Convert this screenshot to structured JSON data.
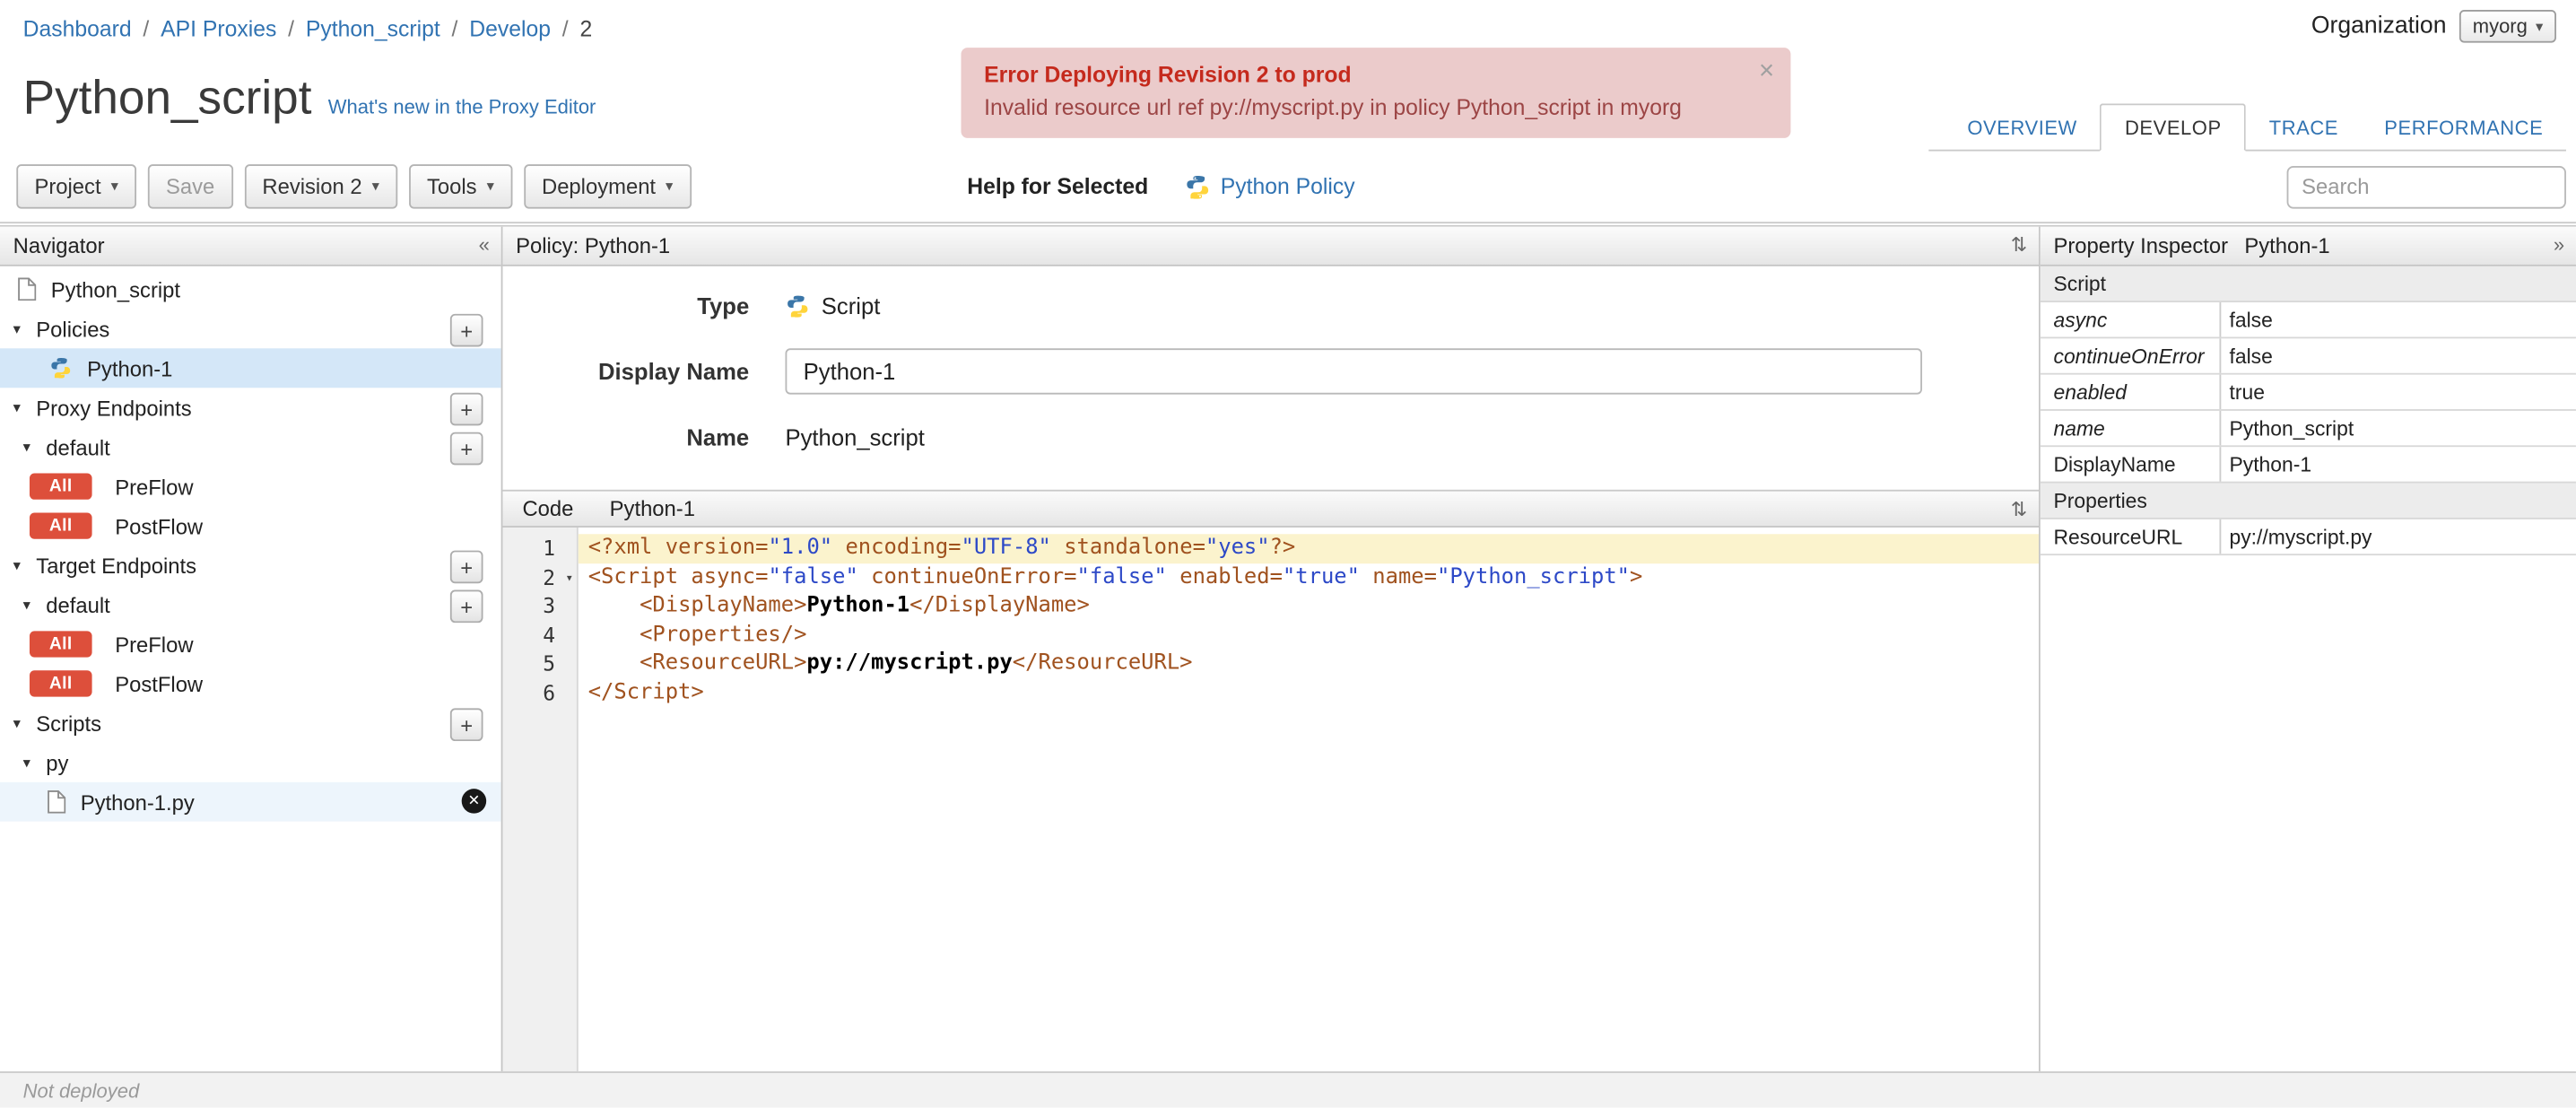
{
  "icons": {
    "caret_down": "▾",
    "collapse_left": "«",
    "expand_right": "»",
    "panel_toggle": "⇅",
    "close": "×",
    "plus": "+",
    "tree_expanded": "▾",
    "delete": "✕"
  },
  "breadcrumb": {
    "sep": "/",
    "items": [
      "Dashboard",
      "API Proxies",
      "Python_script",
      "Develop",
      "2"
    ]
  },
  "organization": {
    "label": "Organization",
    "value": "myorg"
  },
  "error_banner": {
    "title": "Error Deploying Revision 2 to prod",
    "message": "Invalid resource url ref py://myscript.py in policy Python_script in myorg"
  },
  "page": {
    "title": "Python_script",
    "whats_new": "What's new in the Proxy Editor"
  },
  "tabs": [
    {
      "label": "OVERVIEW",
      "active": false
    },
    {
      "label": "DEVELOP",
      "active": true
    },
    {
      "label": "TRACE",
      "active": false
    },
    {
      "label": "PERFORMANCE",
      "active": false
    }
  ],
  "toolbar": {
    "project": "Project",
    "save": "Save",
    "revision": "Revision 2",
    "tools": "Tools",
    "deployment": "Deployment",
    "help_for_selected": "Help for Selected",
    "policy_link": "Python Policy",
    "search_placeholder": "Search"
  },
  "navigator": {
    "title": "Navigator",
    "root": "Python_script",
    "policies": {
      "title": "Policies",
      "item": "Python-1"
    },
    "proxy_endpoints": {
      "title": "Proxy Endpoints",
      "group": "default",
      "flows": [
        {
          "badge": "All",
          "label": "PreFlow"
        },
        {
          "badge": "All",
          "label": "PostFlow"
        }
      ]
    },
    "target_endpoints": {
      "title": "Target Endpoints",
      "group": "default",
      "flows": [
        {
          "badge": "All",
          "label": "PreFlow"
        },
        {
          "badge": "All",
          "label": "PostFlow"
        }
      ]
    },
    "scripts": {
      "title": "Scripts",
      "group": "py",
      "file": "Python-1.py"
    }
  },
  "editor": {
    "panel_title": "Policy: Python-1",
    "form": {
      "type_label": "Type",
      "type_value": "Script",
      "display_name_label": "Display Name",
      "display_name_value": "Python-1",
      "name_label": "Name",
      "name_value": "Python_script"
    },
    "code_header": {
      "label": "Code",
      "file": "Python-1"
    },
    "code_lines": [
      {
        "n": 1,
        "hl": true,
        "tokens": [
          [
            "t",
            "<?xml "
          ],
          [
            "a",
            "version="
          ],
          [
            "v",
            "\"1.0\""
          ],
          [
            "p",
            " "
          ],
          [
            "a",
            "encoding="
          ],
          [
            "v",
            "\"UTF-8\""
          ],
          [
            "p",
            " "
          ],
          [
            "a",
            "standalone="
          ],
          [
            "v",
            "\"yes\""
          ],
          [
            "t",
            "?>"
          ]
        ]
      },
      {
        "n": 2,
        "fold": true,
        "tokens": [
          [
            "t",
            "<Script "
          ],
          [
            "a",
            "async="
          ],
          [
            "v",
            "\"false\""
          ],
          [
            "p",
            " "
          ],
          [
            "a",
            "continueOnError="
          ],
          [
            "v",
            "\"false\""
          ],
          [
            "p",
            " "
          ],
          [
            "a",
            "enabled="
          ],
          [
            "v",
            "\"true\""
          ],
          [
            "p",
            " "
          ],
          [
            "a",
            "name="
          ],
          [
            "v",
            "\"Python_script\""
          ],
          [
            "t",
            ">"
          ]
        ]
      },
      {
        "n": 3,
        "tokens": [
          [
            "p",
            "    "
          ],
          [
            "t",
            "<DisplayName>"
          ],
          [
            "x",
            "Python-1"
          ],
          [
            "t",
            "</DisplayName>"
          ]
        ]
      },
      {
        "n": 4,
        "tokens": [
          [
            "p",
            "    "
          ],
          [
            "t",
            "<Properties/>"
          ]
        ]
      },
      {
        "n": 5,
        "tokens": [
          [
            "p",
            "    "
          ],
          [
            "t",
            "<ResourceURL>"
          ],
          [
            "x",
            "py://myscript.py"
          ],
          [
            "t",
            "</ResourceURL>"
          ]
        ]
      },
      {
        "n": 6,
        "tokens": [
          [
            "t",
            "</Script>"
          ]
        ]
      }
    ]
  },
  "inspector": {
    "title": "Property Inspector",
    "subtitle": "Python-1",
    "rows": [
      {
        "kind": "section",
        "label": "Script"
      },
      {
        "kind": "kv",
        "label": "async",
        "value": "false"
      },
      {
        "kind": "kv",
        "label": "continueOnError",
        "value": "false"
      },
      {
        "kind": "kv",
        "label": "enabled",
        "value": "true"
      },
      {
        "kind": "kv",
        "label": "name",
        "value": "Python_script"
      },
      {
        "kind": "kv",
        "label": "DisplayName",
        "value": "Python-1"
      },
      {
        "kind": "section",
        "label": "Properties"
      },
      {
        "kind": "kv",
        "label": "ResourceURL",
        "value": "py://myscript.py"
      }
    ]
  },
  "status_bar": {
    "text": "Not deployed"
  }
}
